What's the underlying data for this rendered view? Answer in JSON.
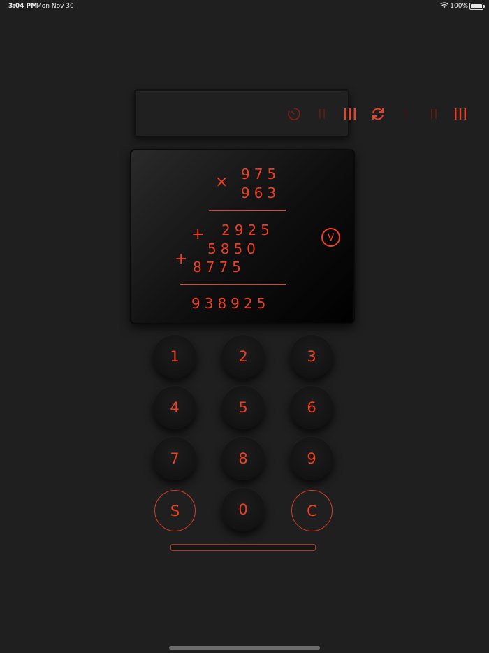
{
  "status_bar": {
    "time": "3:04 PM",
    "date": "Mon Nov 30",
    "battery": "100%"
  },
  "toolbar": {
    "tools": [
      {
        "icon": "timer-icon"
      },
      {
        "icon": "double-bar-icon"
      },
      {
        "icon": "triple-bar-icon"
      },
      {
        "icon": "refresh-icon"
      },
      {
        "icon": "single-bar-icon"
      },
      {
        "icon": "double-bar-icon"
      },
      {
        "icon": "triple-bar-icon"
      }
    ]
  },
  "display": {
    "operator_multiply": "×",
    "multiplicand": "975",
    "multiplier": "963",
    "partials": [
      "2925",
      "5850",
      "8775"
    ],
    "operator_plus": "+",
    "result": "938925",
    "verify_label": "V"
  },
  "keypad": {
    "keys": [
      "1",
      "2",
      "3",
      "4",
      "5",
      "6",
      "7",
      "8",
      "9",
      "S",
      "0",
      "C"
    ]
  },
  "colors": {
    "accent": "#ee3f22",
    "background": "#1f1f20"
  }
}
